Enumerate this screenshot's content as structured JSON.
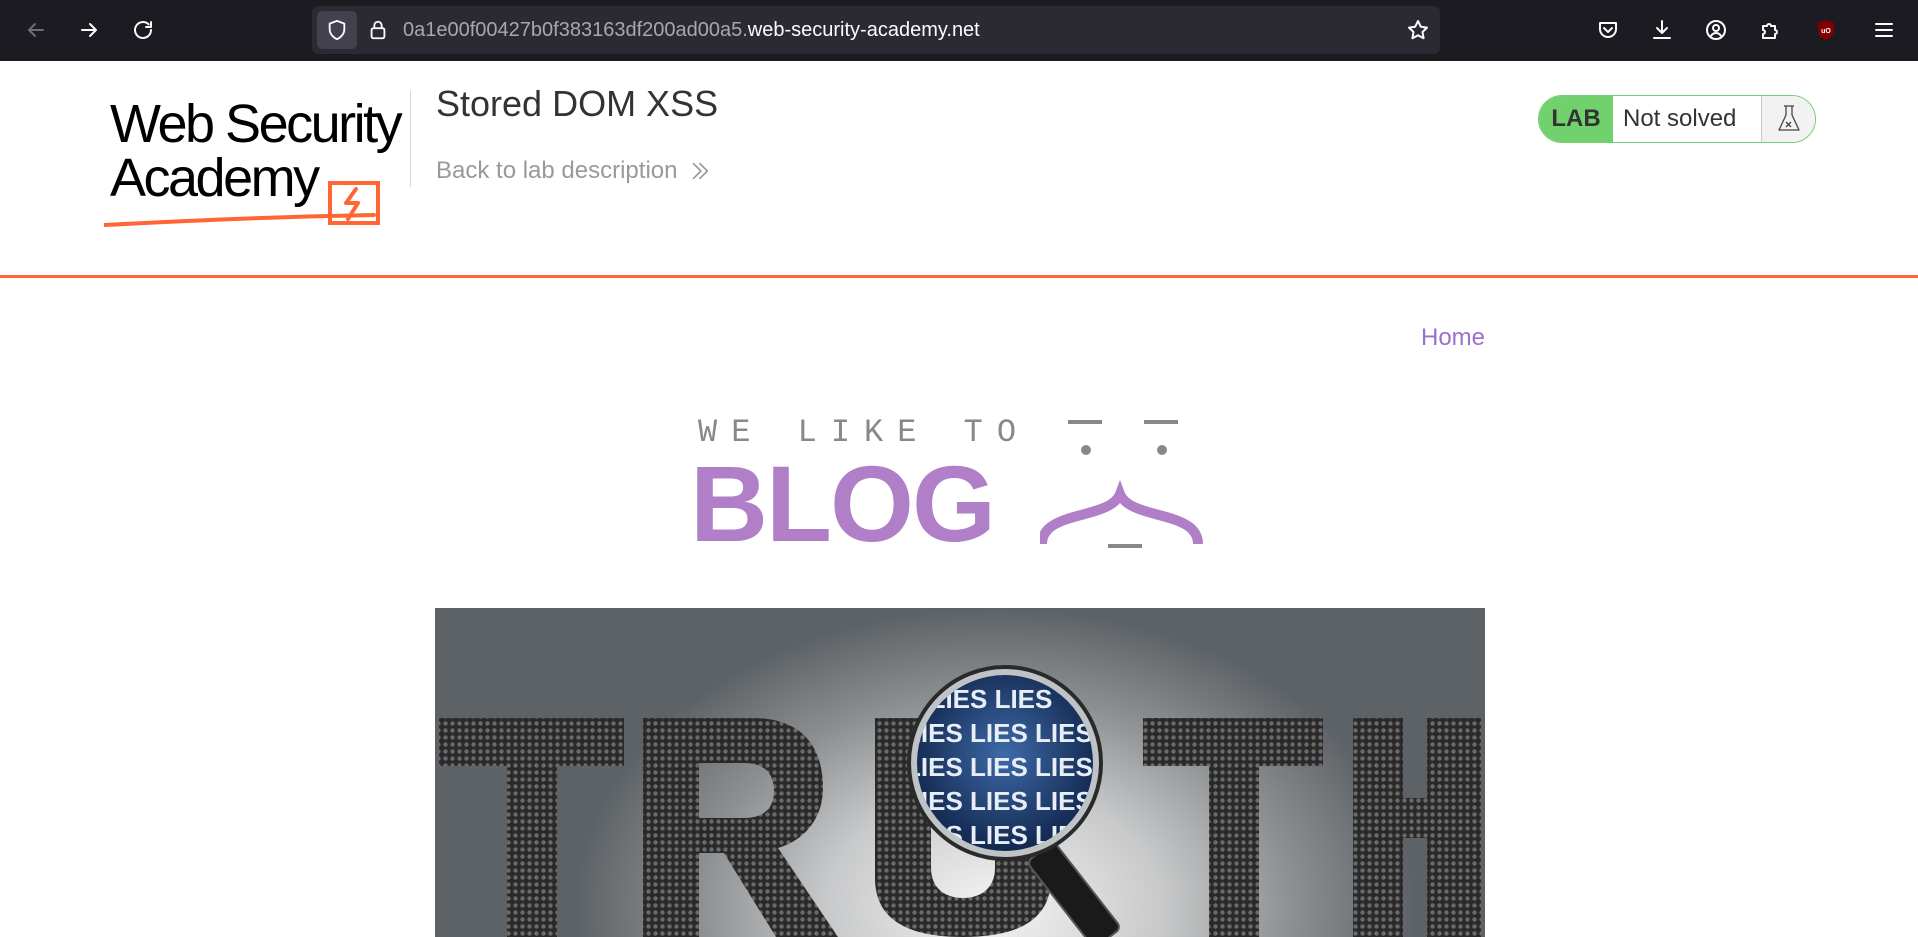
{
  "browser": {
    "url_prefix": "0a1e00f00427b0f383163df200ad00a5.",
    "url_domain": "web-security-academy.net"
  },
  "academy": {
    "logo_line1": "Web Security",
    "logo_line2": "Academy",
    "lab_title": "Stored DOM XSS",
    "back_link": "Back to lab description",
    "lab_badge": "LAB",
    "lab_status": "Not solved",
    "accent_color": "#ff6633",
    "status_color": "#70d16d"
  },
  "blog": {
    "nav_home": "Home",
    "tagline": "WE LIKE TO",
    "title": "BLOG",
    "brand_color": "#b07fc7"
  },
  "hero_image": {
    "word": "TRUTH",
    "lens_word": "LIES"
  }
}
